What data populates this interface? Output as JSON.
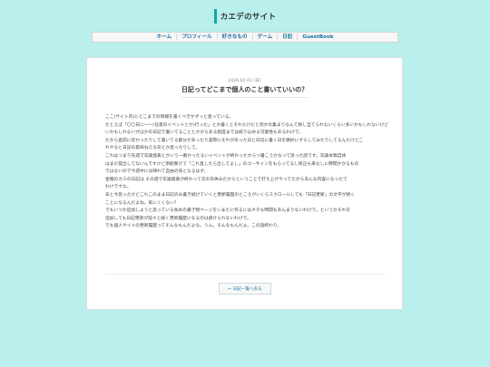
{
  "site": {
    "title": "カエデのサイト"
  },
  "nav": {
    "items": [
      "ホーム",
      "プロフィール",
      "好きなもの",
      "ゲーム",
      "日記",
      "GuestBook"
    ]
  },
  "post": {
    "date": "2026.02.01 (日)",
    "title": "日記ってどこまで個人のこと書いていいの？",
    "lines": [
      "ここ(サイト内)にどこまでの情報を書くべきかずっと迷っている。",
      "たとえば「〇〇日に〜〜(任意のイベントとか)行った」とか書くとそれだけだと何かの集まりなんて探し当てられないくらい多いかもしれないけど",
      "いかもしれないがほかの日記で書いてることとかからある程度までは絞り込める可能性もあるわけで。",
      "だから直前に近かったりして書いてる部分があったり実際にそれがあった日と日記に書く日を微妙にずらしてみたりしてるんだけどこ",
      "れやると日記の意味ねえなあとか思ったりして。",
      "これはつまり先週で卒論発表とかいう一番かったるいイベントが終わったからつ書こうかなって思った話です。卒論本稿自体",
      "はまだ提出してないんですけど添削受けて「これ直したら出してよし」のゴーサインをもらってるし修正も来なしに時間かかるもの",
      "ではないので今週中には晴れて自由の身となるはず。",
      "金曜のカスの日記は その週で卒論発表が終わって次の日休みだからということで打ち上げやってたからあんな内容になったて",
      "わけですな。",
      "あと今思ったけどこれこのまま日記のみ書き続けていくと更新履歴のところがいくらスクロールしても「日記更新」の文字が続く",
      "ことになるんだよね。気にくくない？",
      "でもいつか追加しようと思っている長めの書き物ページをいまだに作るにはネタも時間もあんまりないわけで。というかそれを",
      "追加しても日記更新が延々と続く更新履歴になるのは避けられないわけで。",
      "でも個人サイトの更新履歴ってそんなもんだよな。うん。そんなもんだよ。この話終わり。"
    ]
  },
  "back_button": {
    "label": "← 日記一覧へ戻る"
  }
}
